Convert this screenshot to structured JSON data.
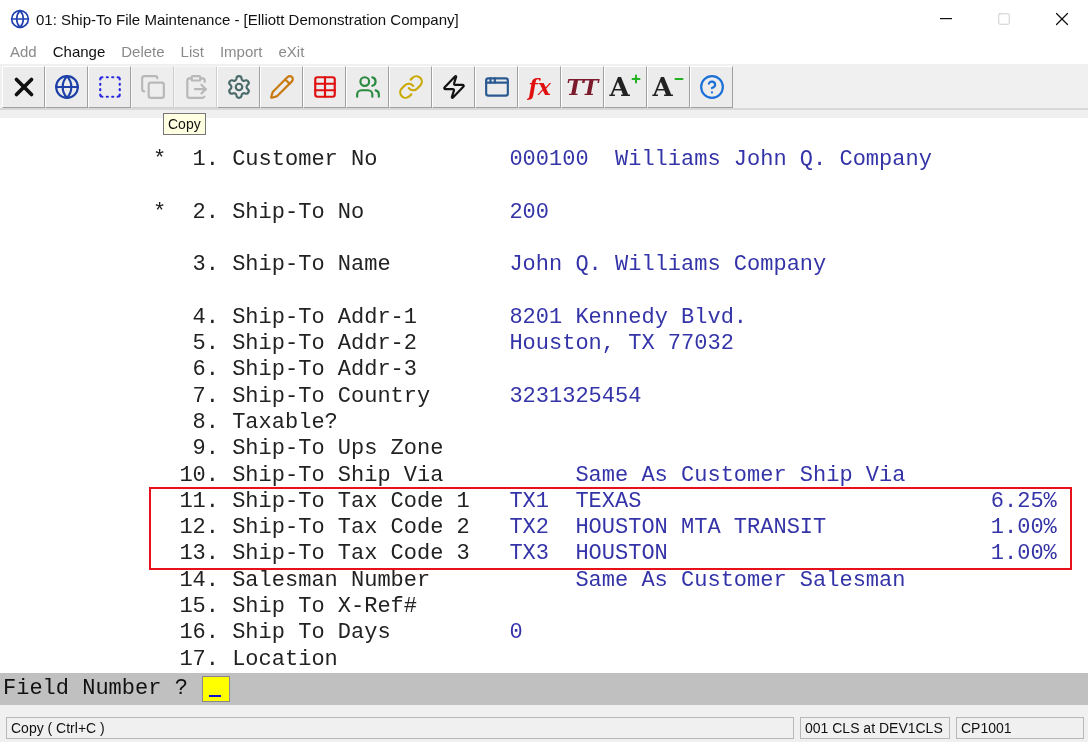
{
  "window": {
    "title": "01: Ship-To File Maintenance - [Elliott Demonstration Company]"
  },
  "menu": [
    {
      "label": "Add",
      "disabled": true
    },
    {
      "label": "Change",
      "disabled": false
    },
    {
      "label": "Delete",
      "disabled": true
    },
    {
      "label": "List",
      "disabled": true
    },
    {
      "label": "Import",
      "disabled": true
    },
    {
      "label": "eXit",
      "disabled": true
    }
  ],
  "toolbar": [
    {
      "kind": "close",
      "disabled": false
    },
    {
      "kind": "globe",
      "disabled": false
    },
    {
      "kind": "select",
      "disabled": false
    },
    {
      "kind": "copy",
      "disabled": true
    },
    {
      "kind": "paste",
      "disabled": true
    },
    {
      "kind": "settings",
      "disabled": false
    },
    {
      "kind": "edit",
      "disabled": false
    },
    {
      "kind": "table",
      "disabled": false
    },
    {
      "kind": "users",
      "disabled": false
    },
    {
      "kind": "link",
      "disabled": false
    },
    {
      "kind": "lightning",
      "disabled": false
    },
    {
      "kind": "window",
      "disabled": false
    },
    {
      "kind": "glyph",
      "glyph": "fx",
      "disabled": false
    },
    {
      "kind": "glyph",
      "glyph": "TT",
      "disabled": false
    },
    {
      "kind": "font_up",
      "glyph": "A",
      "disabled": false
    },
    {
      "kind": "font_down",
      "glyph": "A",
      "disabled": false
    },
    {
      "kind": "help",
      "disabled": false
    }
  ],
  "tooltip": "Copy",
  "sections": [
    {
      "kind": "spaced",
      "fields": [
        {
          "marker": "*",
          "number": "1.",
          "label": "Customer No",
          "kind": "code_name",
          "value": "000100",
          "description": "Williams John Q. Company"
        }
      ]
    },
    {
      "kind": "spaced",
      "fields": [
        {
          "marker": "*",
          "number": "2.",
          "label": "Ship-To No",
          "kind": "plain",
          "value": "200"
        }
      ]
    },
    {
      "kind": "spaced",
      "fields": [
        {
          "number": "3.",
          "label": "Ship-To Name",
          "kind": "plain",
          "value": "John Q. Williams Company"
        }
      ]
    },
    {
      "kind": "plain",
      "fields": [
        {
          "number": "4.",
          "label": "Ship-To Addr-1",
          "kind": "plain",
          "value": "8201 Kennedy Blvd."
        },
        {
          "number": "5.",
          "label": "Ship-To Addr-2",
          "kind": "plain",
          "value": "Houston, TX 77032"
        },
        {
          "number": "6.",
          "label": "Ship-To Addr-3",
          "kind": "plain"
        },
        {
          "number": "7.",
          "label": "Ship-To Country",
          "kind": "plain",
          "value": "3231325454"
        },
        {
          "number": "8.",
          "label": "Taxable?",
          "kind": "plain"
        },
        {
          "number": "9.",
          "label": "Ship-To Ups Zone",
          "kind": "plain"
        },
        {
          "number": "10.",
          "label": "Ship-To Ship Via",
          "kind": "note",
          "note": "Same As Customer Ship Via"
        }
      ]
    },
    {
      "kind": "highlighted",
      "fields": [
        {
          "number": "11.",
          "label": "Ship-To Tax Code 1",
          "kind": "tax_code",
          "value": "TX1",
          "description": "TEXAS",
          "rate": "6.25%"
        },
        {
          "number": "12.",
          "label": "Ship-To Tax Code 2",
          "kind": "tax_code",
          "value": "TX2",
          "description": "HOUSTON MTA TRANSIT",
          "rate": "1.00%"
        },
        {
          "number": "13.",
          "label": "Ship-To Tax Code 3",
          "kind": "tax_code",
          "value": "TX3",
          "description": "HOUSTON",
          "rate": "1.00%"
        }
      ]
    },
    {
      "kind": "plain",
      "fields": [
        {
          "number": "14.",
          "label": "Salesman Number",
          "kind": "note",
          "note": "Same As Customer Salesman"
        },
        {
          "number": "15.",
          "label": "Ship To X-Ref#",
          "kind": "plain"
        },
        {
          "number": "16.",
          "label": "Ship To Days",
          "kind": "plain",
          "value": "0"
        },
        {
          "number": "17.",
          "label": "Location",
          "kind": "plain"
        }
      ]
    }
  ],
  "prompt": {
    "label": "Field Number ?"
  },
  "status_bar": [
    "Copy ( Ctrl+C )",
    "001 CLS at DEV1CLS",
    "CP1001"
  ]
}
